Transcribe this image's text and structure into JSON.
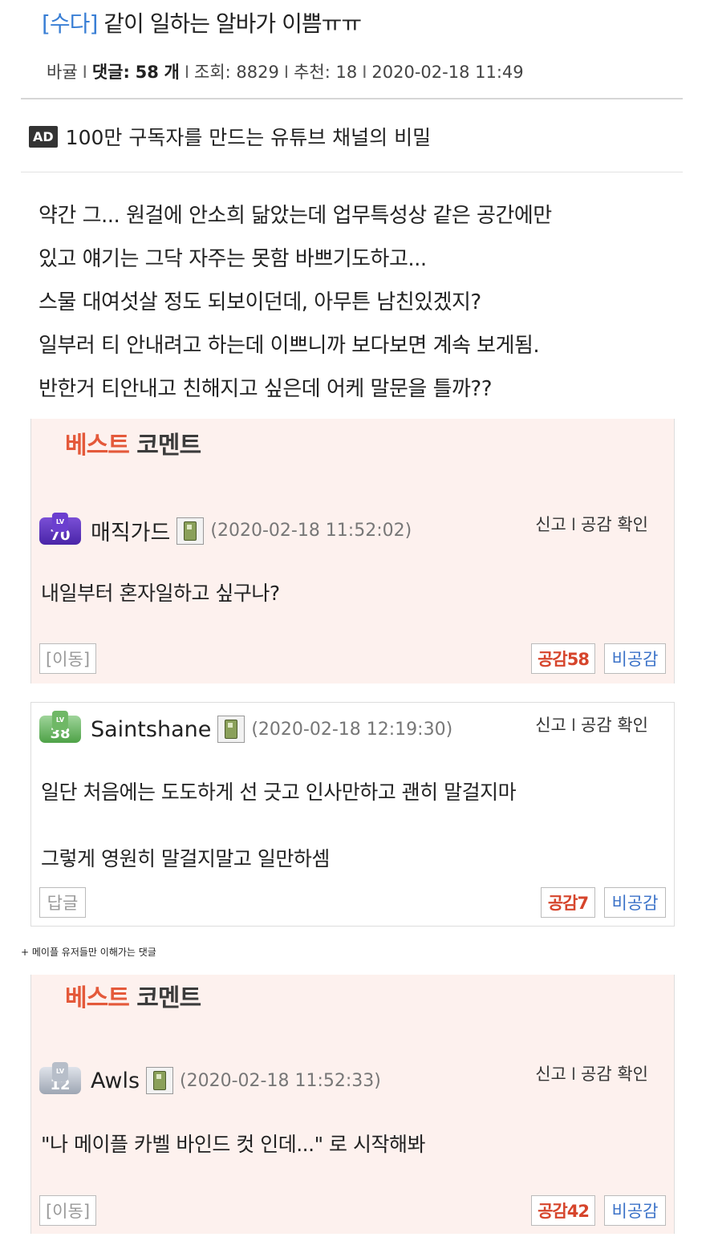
{
  "post": {
    "category": "[수다]",
    "title": "같이 일하는 알바가 이쁨ㅠㅠ",
    "author": "바귤",
    "comments_label": "댓글:",
    "comments_count": "58",
    "comments_unit": "개",
    "views_label": "조회: 8829",
    "recommend_label": "추천: 18",
    "datetime": "2020-02-18 11:49",
    "separator": "I"
  },
  "ad": {
    "badge": "AD",
    "text": "100만 구독자를 만드는 유튜브 채널의 비밀"
  },
  "body_lines": [
    "약간 그... 원걸에 안소희 닮았는데 업무특성상 같은 공간에만",
    "있고 얘기는 그닥 자주는 못함 바쁘기도하고...",
    "스물 대여섯살 정도 되보이던데, 아무튼 남친있겠지?",
    "일부러 티 안내려고 하는데 이쁘니까 보다보면 계속 보게됨.",
    "반한거 티안내고 친해지고 싶은데 어케 말문을 틀까??"
  ],
  "best_label": {
    "part1": "베스트",
    "part2": "코멘트"
  },
  "actions": {
    "report": "신고",
    "separator": "I",
    "view_likes": "공감 확인"
  },
  "comments": [
    {
      "level": "70",
      "lv_tag": "LV",
      "level_color": "purple",
      "nick": "매직가드",
      "date": "(2020-02-18 11:52:02)",
      "lines": [
        "내일부터 혼자일하고 싶구나?"
      ],
      "left_button": "[이동]",
      "like": "공감58",
      "dislike": "비공감"
    },
    {
      "level": "38",
      "lv_tag": "LV",
      "level_color": "green",
      "nick": "Saintshane",
      "date": "(2020-02-18 12:19:30)",
      "lines": [
        "일단 처음에는 도도하게 선 긋고 인사만하고 괜히 말걸지마",
        "그렇게 영원히 말걸지말고 일만하셈"
      ],
      "left_button": "답글",
      "like": "공감7",
      "dislike": "비공감"
    },
    {
      "level": "12",
      "lv_tag": "LV",
      "level_color": "gray",
      "nick": "Awls",
      "date": "(2020-02-18 11:52:33)",
      "lines": [
        "\"나 메이플 카벨 바인드 컷 인데...\"  로 시작해봐"
      ],
      "left_button": "[이동]",
      "like": "공감42",
      "dislike": "비공감"
    }
  ],
  "note": "+ 메이플 유저들만 이해가는 댓글"
}
